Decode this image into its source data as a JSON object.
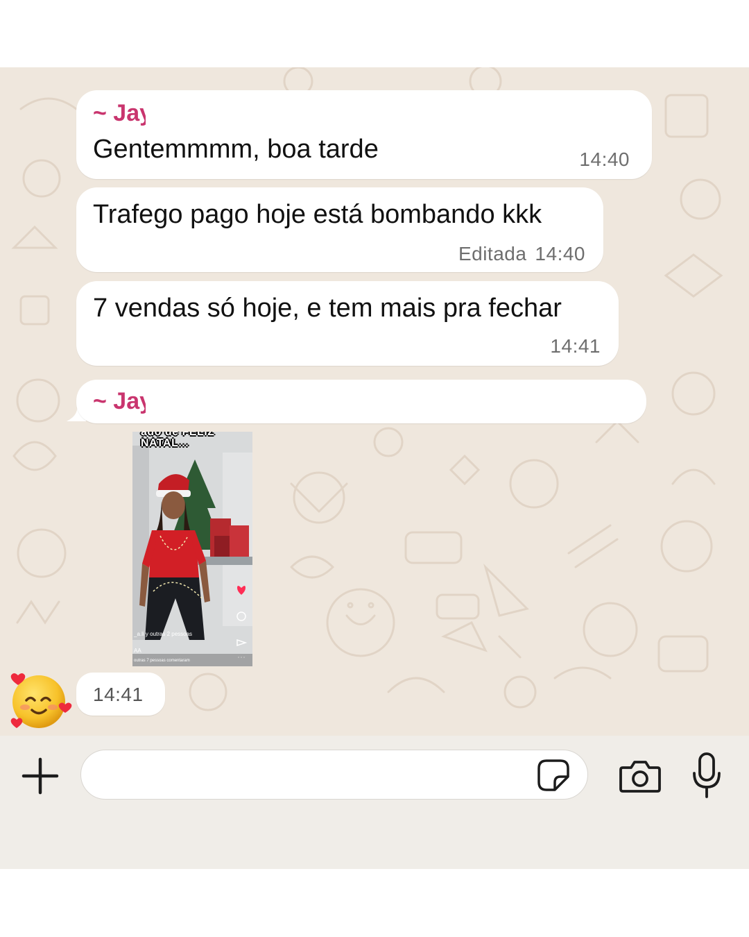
{
  "chat": {
    "messages": [
      {
        "sender": "~ Jay",
        "text": "Gentemmmm, boa tarde",
        "time": "14:40",
        "edited": ""
      },
      {
        "sender": "",
        "text": "Trafego pago hoje está bombando kkk",
        "time": "14:40",
        "edited": "Editada"
      },
      {
        "sender": "",
        "text": "7 vendas só hoje, e tem mais pra fechar",
        "time": "14:41",
        "edited": ""
      }
    ],
    "media_message": {
      "sender": "~ Jay",
      "time": "14:41",
      "video": {
        "caption_line1": "ado de FELIZ",
        "caption_line2": "NATAL...",
        "user_text": "_a.li y outras 2 pessoas",
        "code_text": "AA",
        "comment_text": "outras 7 pessoas comentaram"
      }
    }
  },
  "composer": {
    "input_value": "",
    "placeholder": ""
  },
  "icons": {
    "plus": "plus-icon",
    "sticker": "sticker-icon",
    "camera": "camera-icon",
    "mic": "microphone-icon",
    "avatar": "smiling-face-with-hearts-emoji"
  },
  "colors": {
    "sender_name": "#c9356e",
    "wallpaper": "#efe7dd",
    "bubble": "#ffffff",
    "time": "#6e6e6e"
  }
}
